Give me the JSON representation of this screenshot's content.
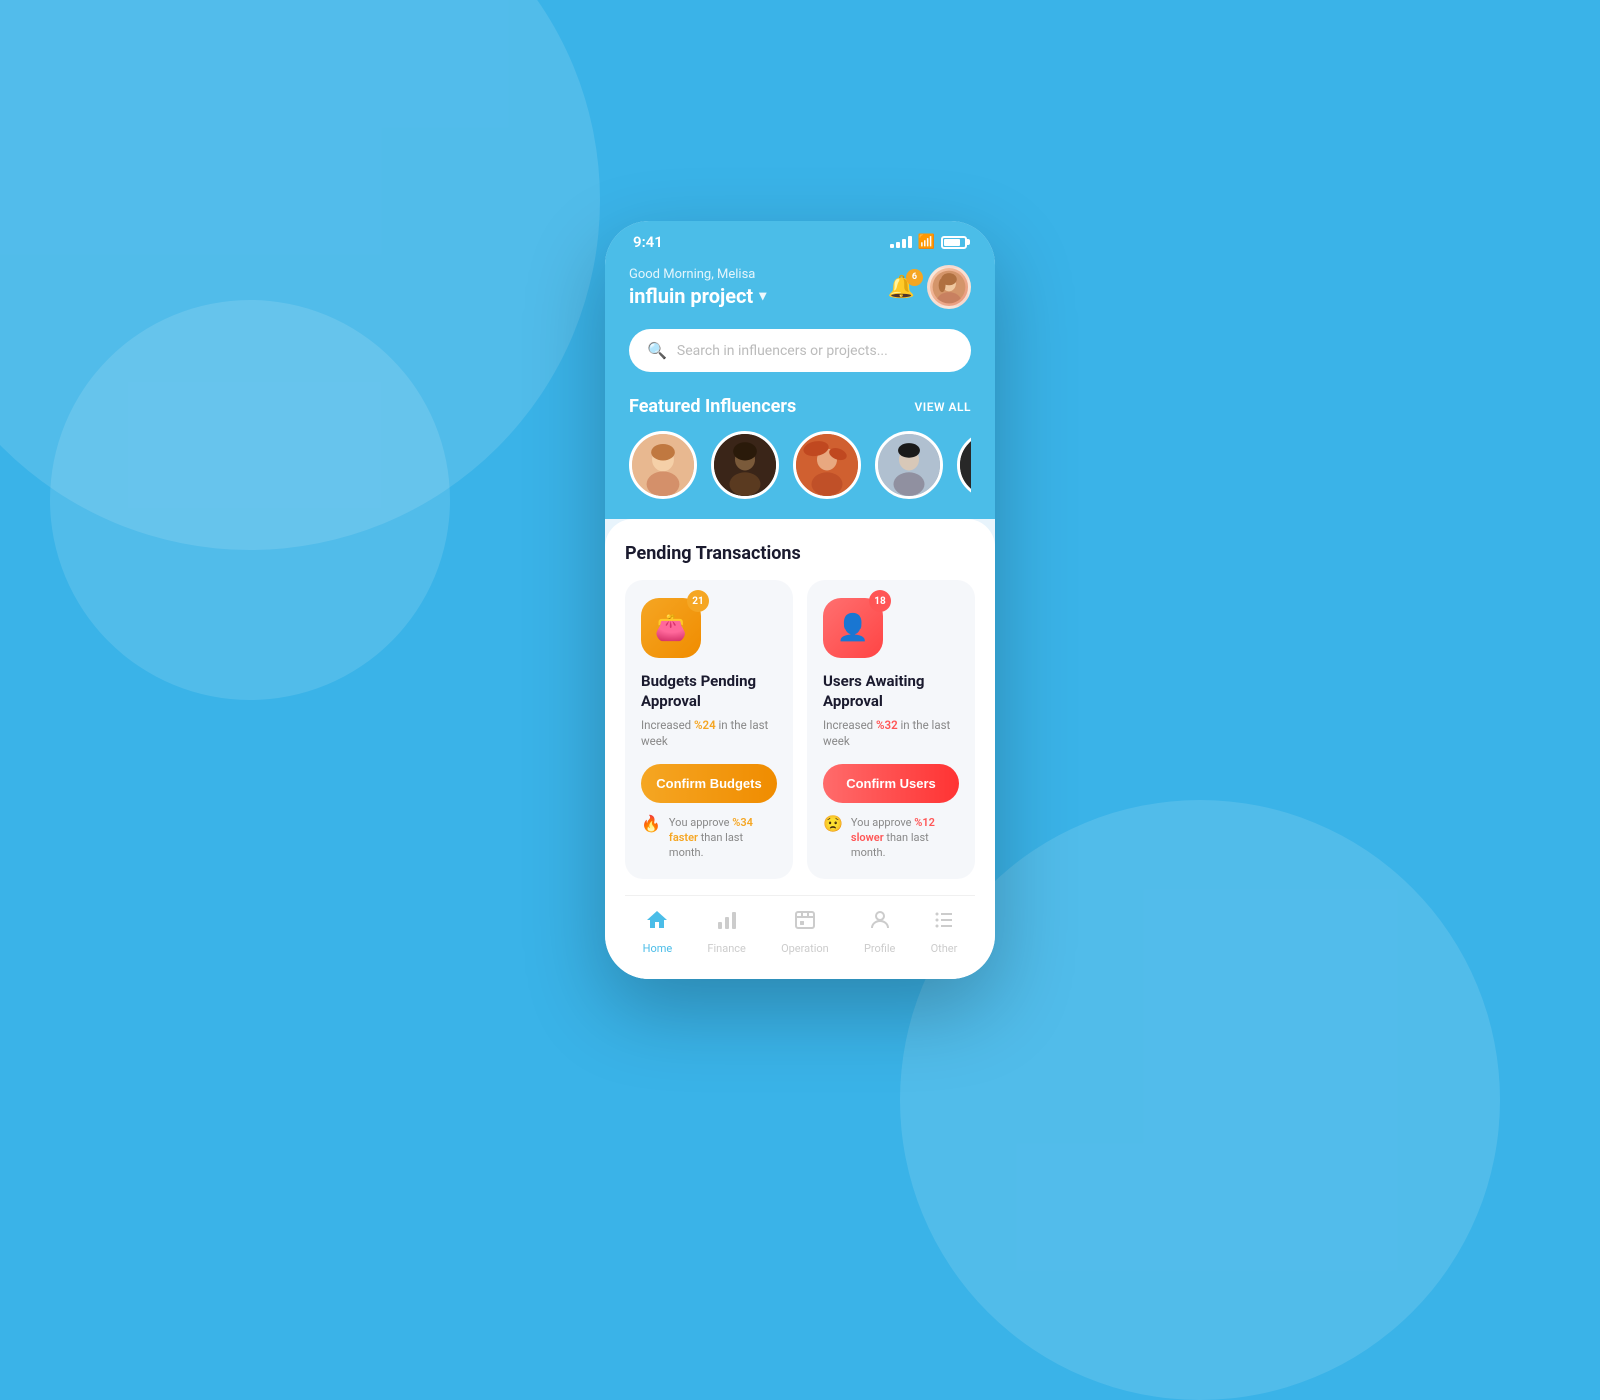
{
  "background": {
    "color": "#3ab3e8"
  },
  "status_bar": {
    "time": "9:41",
    "signal_count": 4,
    "notif_count": "6"
  },
  "header": {
    "greeting": "Good Morning, Melisa",
    "project_name": "influin project",
    "chevron": "▾",
    "notif_badge": "6"
  },
  "search": {
    "placeholder": "Search in influencers or projects..."
  },
  "featured": {
    "title": "Featured Influencers",
    "view_all": "VIEW ALL"
  },
  "pending": {
    "title": "Pending Transactions"
  },
  "budget_card": {
    "badge": "21",
    "title": "Budgets Pending Approval",
    "subtitle_prefix": "Increased ",
    "subtitle_highlight": "%24",
    "subtitle_suffix": " in the last week",
    "btn_label": "Confirm Budgets",
    "footer_prefix": "You approve ",
    "footer_highlight": "%34 faster",
    "footer_suffix": " than last month."
  },
  "users_card": {
    "badge": "18",
    "title": "Users Awaiting Approval",
    "subtitle_prefix": "Increased ",
    "subtitle_highlight": "%32",
    "subtitle_suffix": " in the last week",
    "btn_label": "Confirm Users",
    "footer_prefix": "You approve ",
    "footer_highlight": "%12 slower",
    "footer_suffix": " than last month."
  },
  "nav": {
    "home": "Home",
    "finance": "Finance",
    "operation": "Operation",
    "profile": "Profile",
    "other": "Other"
  }
}
